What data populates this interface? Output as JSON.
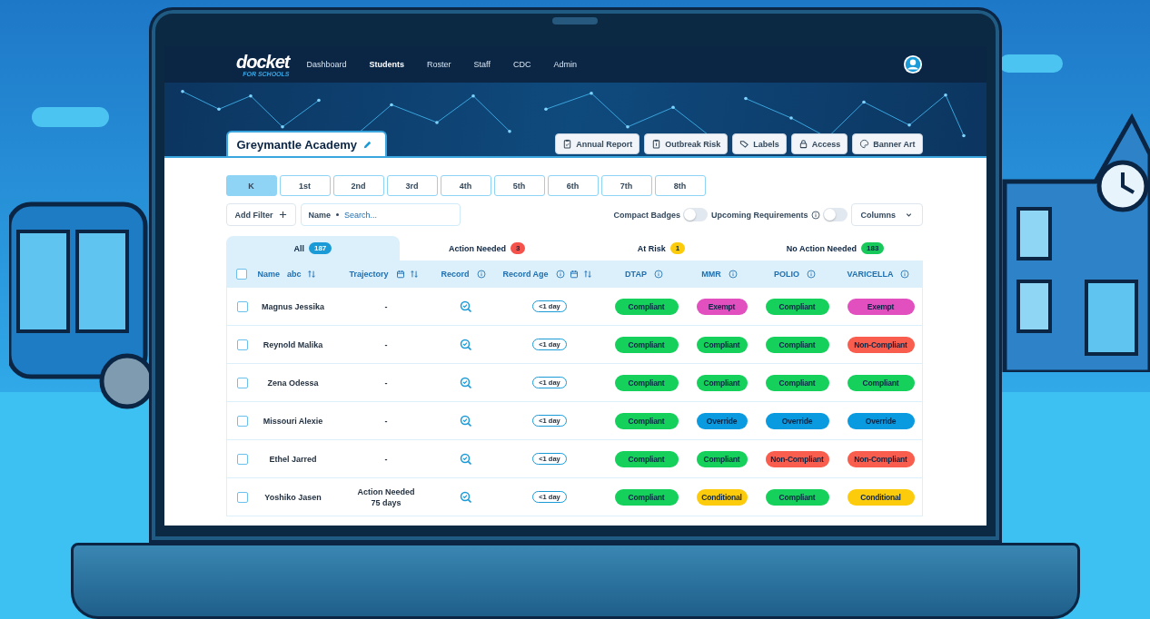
{
  "nav": {
    "logo": "docket",
    "logo_sub": "FOR SCHOOLS",
    "items": [
      {
        "label": "Dashboard",
        "selected": false
      },
      {
        "label": "Students",
        "selected": true
      },
      {
        "label": "Roster",
        "selected": false
      },
      {
        "label": "Staff",
        "selected": false
      },
      {
        "label": "CDC",
        "selected": false
      },
      {
        "label": "Admin",
        "selected": false
      }
    ]
  },
  "school": {
    "name": "Greymantle Academy"
  },
  "actions": [
    {
      "label": "Annual Report",
      "kind": "clipboard"
    },
    {
      "label": "Outbreak Risk",
      "kind": "alert-clipboard"
    },
    {
      "label": "Labels",
      "kind": "tag"
    },
    {
      "label": "Access",
      "kind": "lock"
    },
    {
      "label": "Banner Art",
      "kind": "palette"
    }
  ],
  "grades": [
    {
      "label": "K",
      "selected": true
    },
    {
      "label": "1st",
      "selected": false
    },
    {
      "label": "2nd",
      "selected": false
    },
    {
      "label": "3rd",
      "selected": false
    },
    {
      "label": "4th",
      "selected": false
    },
    {
      "label": "5th",
      "selected": false
    },
    {
      "label": "6th",
      "selected": false
    },
    {
      "label": "7th",
      "selected": false
    },
    {
      "label": "8th",
      "selected": false
    }
  ],
  "filter": {
    "add_label": "Add Filter",
    "field": "Name",
    "placeholder": "Search..."
  },
  "toggles": [
    {
      "label": "Compact Badges",
      "kind": "plain",
      "on": false
    },
    {
      "label": "Upcoming Requirements",
      "kind": "explained",
      "on": false
    }
  ],
  "columns_button": "Columns",
  "status_tabs": [
    {
      "label": "All",
      "count": "187",
      "color": "#1a9ad6",
      "selected": true
    },
    {
      "label": "Action Needed",
      "count": "3",
      "color": "#f4524b",
      "selected": false
    },
    {
      "label": "At Risk",
      "count": "1",
      "color": "#fccb0b",
      "selected": false
    },
    {
      "label": "No Action Needed",
      "count": "183",
      "color": "#16c95a",
      "selected": false
    }
  ],
  "table": {
    "all_checked": false,
    "columns": [
      {
        "label": "Name",
        "tag": "abc",
        "kind": "text"
      },
      {
        "label": "Trajectory",
        "kind": "date"
      },
      {
        "label": "Record",
        "kind": "link"
      },
      {
        "label": "Record Age",
        "kind": "age"
      },
      {
        "label": "DTAP",
        "kind": "status"
      },
      {
        "label": "MMR",
        "kind": "status"
      },
      {
        "label": "POLIO",
        "kind": "status"
      },
      {
        "label": "VARICELLA",
        "kind": "status"
      }
    ],
    "rows": [
      {
        "checked": false,
        "name": "Magnus Jessika",
        "trajectory": "-",
        "record_age": "<1 day",
        "statuses": [
          {
            "text": "Compliant",
            "color": "#16d05c"
          },
          {
            "text": "Exempt",
            "color": "#e24fbf"
          },
          {
            "text": "Compliant",
            "color": "#16d05c"
          },
          {
            "text": "Exempt",
            "color": "#e24fbf"
          }
        ]
      },
      {
        "checked": false,
        "name": "Reynold Malika",
        "trajectory": "-",
        "record_age": "<1 day",
        "statuses": [
          {
            "text": "Compliant",
            "color": "#16d05c"
          },
          {
            "text": "Compliant",
            "color": "#16d05c"
          },
          {
            "text": "Compliant",
            "color": "#16d05c"
          },
          {
            "text": "Non-Compliant",
            "color": "#f95d4d"
          }
        ]
      },
      {
        "checked": false,
        "name": "Zena Odessa",
        "trajectory": "-",
        "record_age": "<1 day",
        "statuses": [
          {
            "text": "Compliant",
            "color": "#16d05c"
          },
          {
            "text": "Compliant",
            "color": "#16d05c"
          },
          {
            "text": "Compliant",
            "color": "#16d05c"
          },
          {
            "text": "Compliant",
            "color": "#16d05c"
          }
        ]
      },
      {
        "checked": false,
        "name": "Missouri Alexie",
        "trajectory": "-",
        "record_age": "<1 day",
        "statuses": [
          {
            "text": "Compliant",
            "color": "#16d05c"
          },
          {
            "text": "Override",
            "color": "#0a9ae0"
          },
          {
            "text": "Override",
            "color": "#0a9ae0"
          },
          {
            "text": "Override",
            "color": "#0a9ae0"
          }
        ]
      },
      {
        "checked": false,
        "name": "Ethel Jarred",
        "trajectory": "-",
        "record_age": "<1 day",
        "statuses": [
          {
            "text": "Compliant",
            "color": "#16d05c"
          },
          {
            "text": "Compliant",
            "color": "#16d05c"
          },
          {
            "text": "Non-Compliant",
            "color": "#f95d4d"
          },
          {
            "text": "Non-Compliant",
            "color": "#f95d4d"
          }
        ]
      },
      {
        "checked": false,
        "name": "Yoshiko Jasen",
        "trajectory": "Action Needed\n75 days",
        "record_age": "<1 day",
        "statuses": [
          {
            "text": "Compliant",
            "color": "#16d05c"
          },
          {
            "text": "Conditional",
            "color": "#fccb0b"
          },
          {
            "text": "Compliant",
            "color": "#16d05c"
          },
          {
            "text": "Conditional",
            "color": "#fccb0b"
          }
        ]
      }
    ]
  }
}
